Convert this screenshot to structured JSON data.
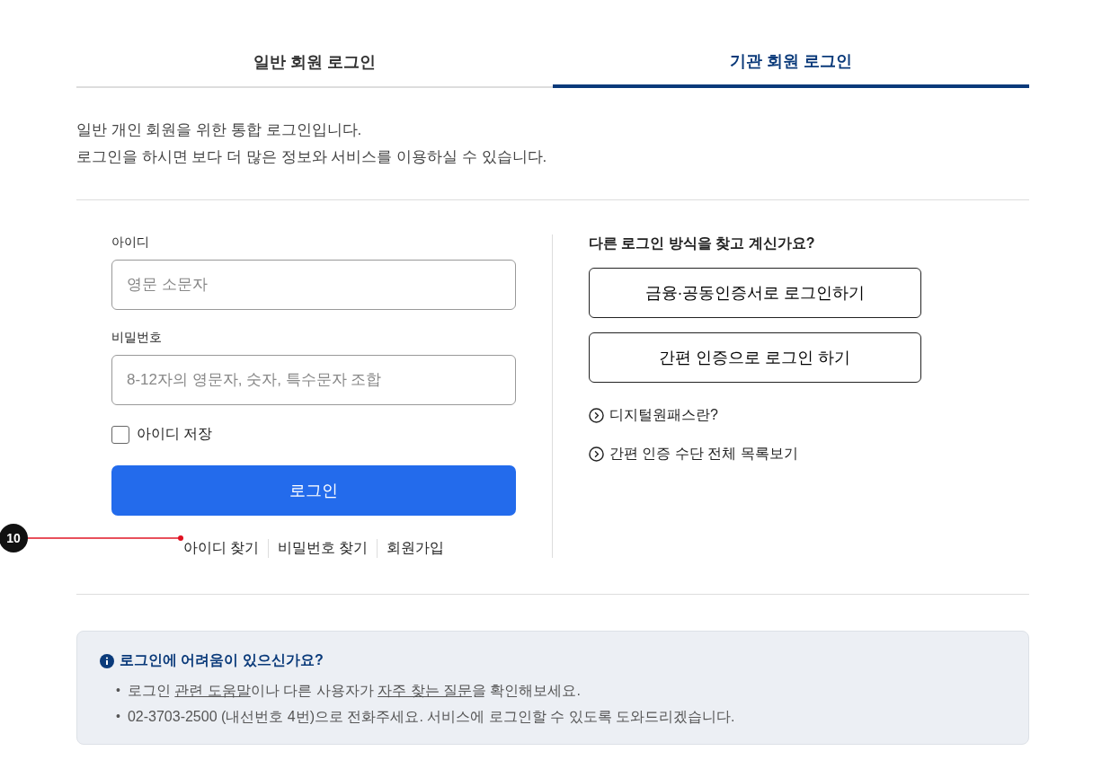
{
  "tabs": [
    {
      "label": "일반 회원 로그인",
      "selected": false
    },
    {
      "label": "기관 회원 로그인",
      "selected": true
    }
  ],
  "intro": [
    "일반 개인 회원을 위한 통합 로그인입니다.",
    "로그인을 하시면 보다 더 많은 정보와 서비스를 이용하실 수 있습니다."
  ],
  "form": {
    "id_label": "아이디",
    "id_placeholder": "영문 소문자",
    "pw_label": "비밀번호",
    "pw_placeholder": "8-12자의 영문자, 숫자, 특수문자 조합",
    "remember": {
      "label": "아이디 저장",
      "checked": false
    },
    "submit": "로그인",
    "links": [
      "아이디 찾기",
      "비밀번호 찾기",
      "회원가입"
    ]
  },
  "alternatives": {
    "title": "다른 로그인 방식을 찾고 계신가요?",
    "buttons": [
      "금융·공동인증서로 로그인하기",
      "간편 인증으로 로그인 하기"
    ],
    "links": [
      "디지털원패스란?",
      "간편 인증 수단 전체 목록보기"
    ]
  },
  "annotation": {
    "label": "10"
  },
  "help": {
    "title": "로그인에 어려움이 있으신가요?",
    "items": [
      {
        "bullet": "•",
        "parts": [
          {
            "text": "로그인 ",
            "link": false
          },
          {
            "text": "관련 도움말",
            "link": true
          },
          {
            "text": "이나 다른 사용자가 ",
            "link": false
          },
          {
            "text": "자주 찾는 질문",
            "link": true
          },
          {
            "text": "을 확인해보세요.",
            "link": false
          }
        ]
      },
      {
        "bullet": "•",
        "parts": [
          {
            "text": "02-3703-2500 (내선번호 4번)으로 전화주세요. 서비스에 로그인할 수 있도록 도와드리겠습니다.",
            "link": false
          }
        ]
      }
    ]
  }
}
